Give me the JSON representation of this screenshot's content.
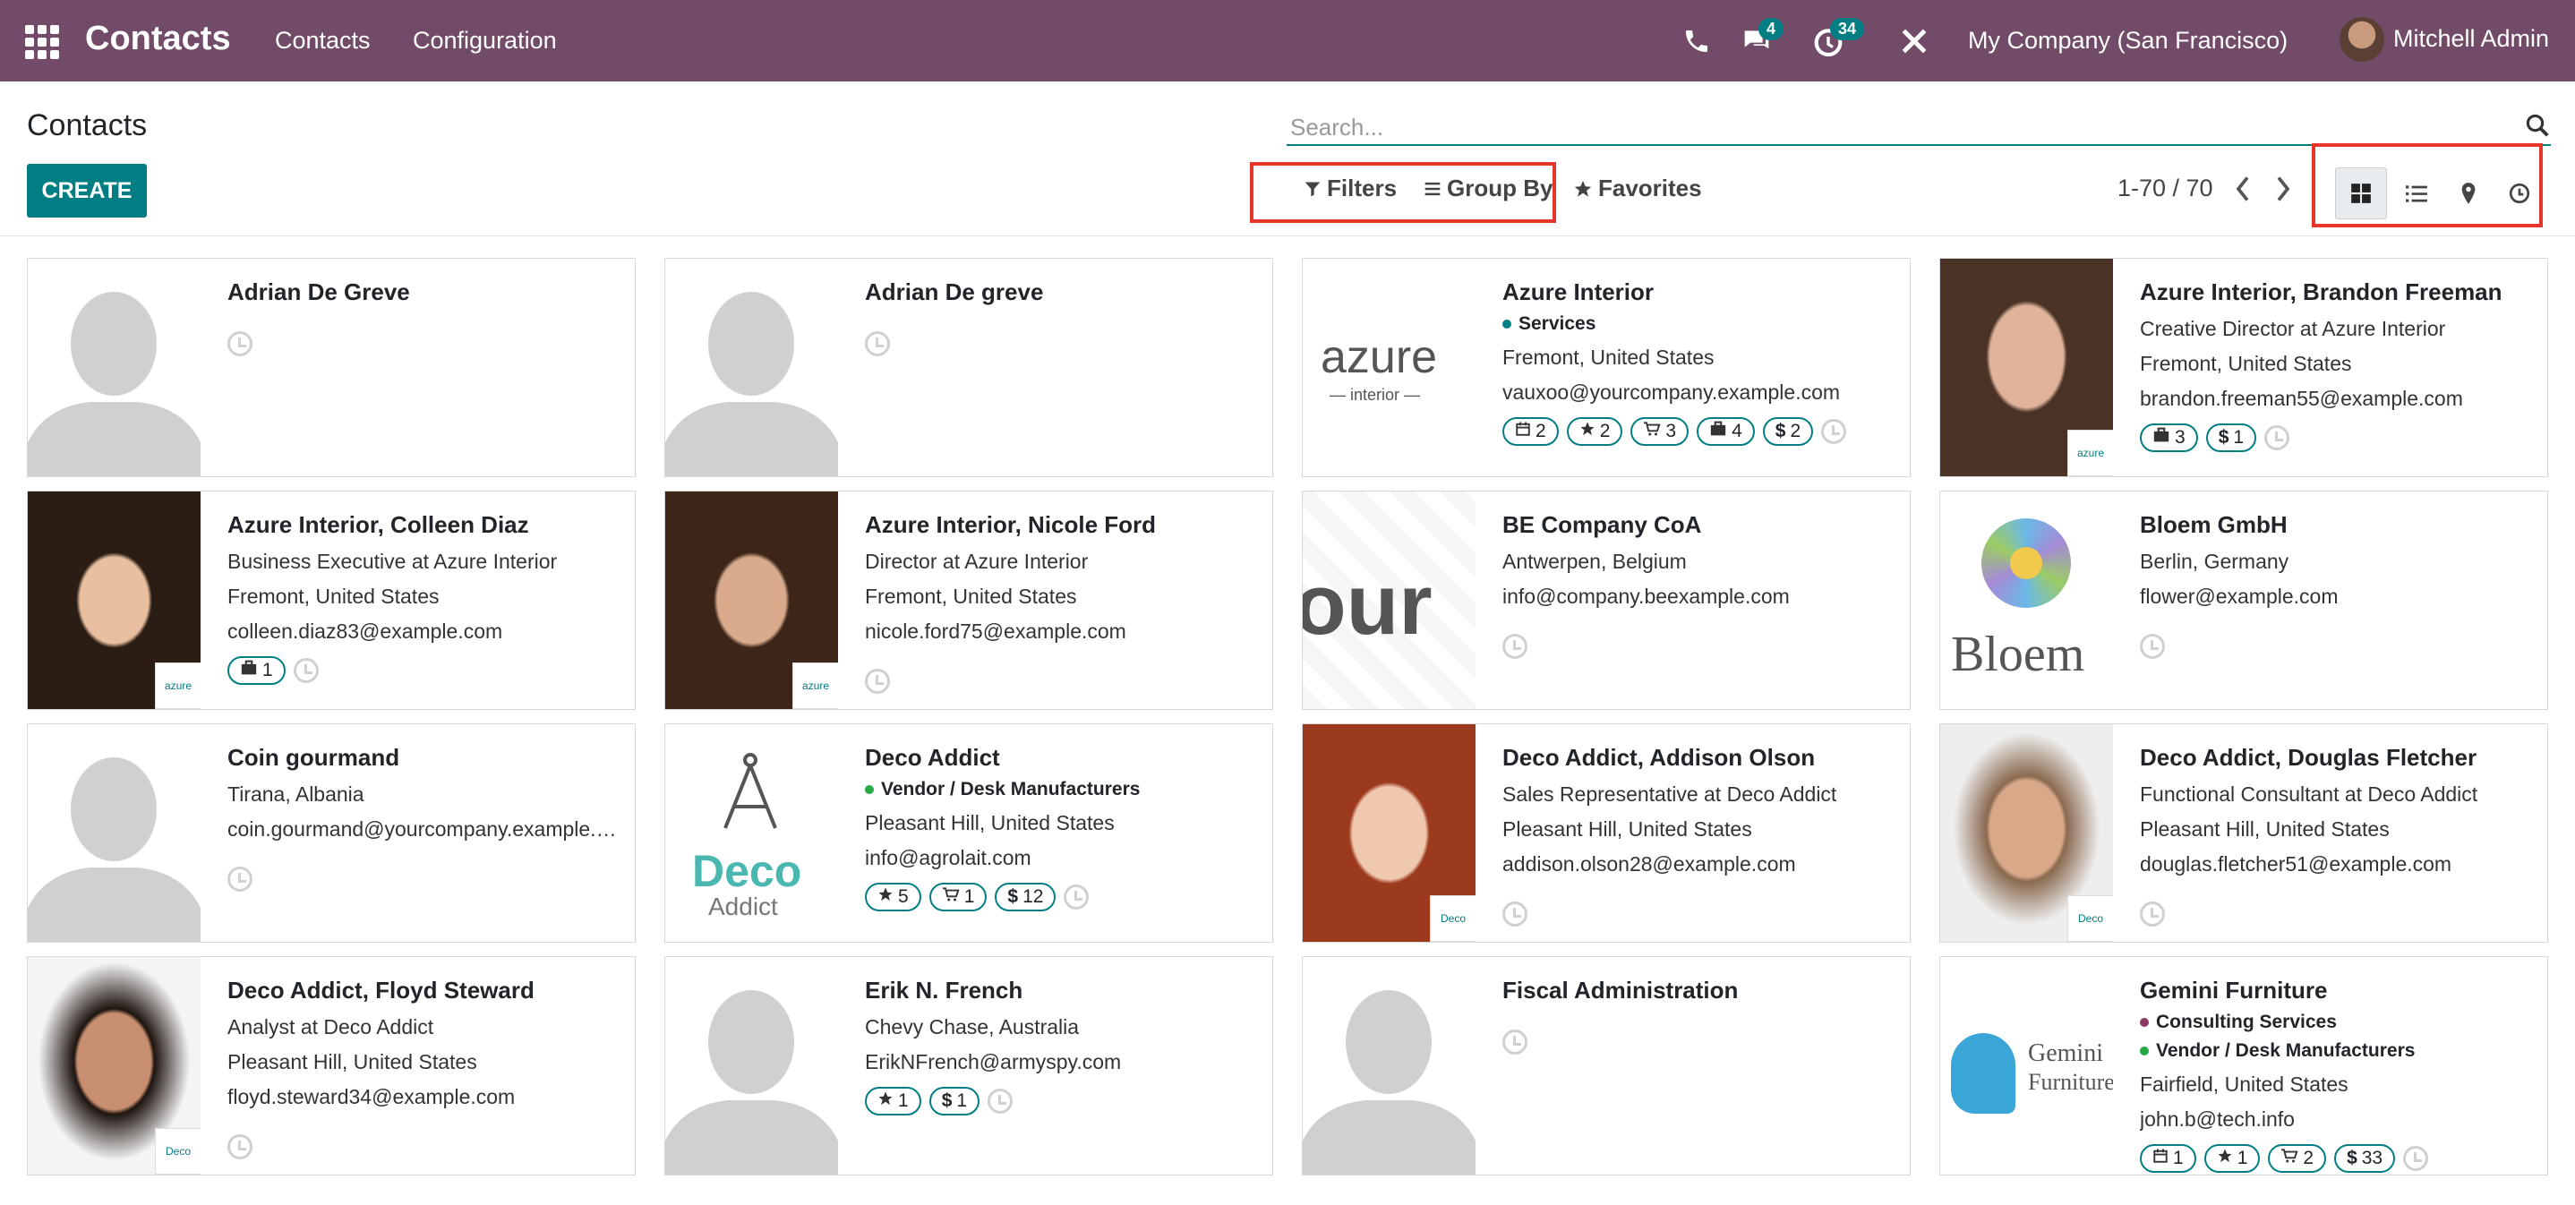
{
  "app": {
    "title": "Contacts",
    "menu": [
      "Contacts",
      "Configuration"
    ],
    "messages_badge": "4",
    "activity_badge": "34",
    "company": "My Company (San Francisco)",
    "user": "Mitchell Admin"
  },
  "controlpanel": {
    "breadcrumb": "Contacts",
    "create_label": "CREATE",
    "search_placeholder": "Search...",
    "filters_label": "Filters",
    "groupby_label": "Group By",
    "favorites_label": "Favorites",
    "pager": "1-70 / 70"
  },
  "colors": {
    "brand": "#714B67",
    "accent": "#017e84",
    "highlight": "#e53629"
  },
  "contacts": [
    {
      "name": "Adrian De Greve",
      "lines": [],
      "tags": [],
      "badges": [],
      "image": "placeholder"
    },
    {
      "name": "Adrian De greve",
      "lines": [],
      "tags": [],
      "badges": [],
      "image": "placeholder"
    },
    {
      "name": "Azure Interior",
      "tags": [
        {
          "label": "Services",
          "color": "#017e84"
        }
      ],
      "lines": [
        "Fremont, United States",
        "vauxoo@yourcompany.example.com"
      ],
      "badges": [
        {
          "icon": "calendar-icon",
          "count": "2"
        },
        {
          "icon": "star-icon",
          "count": "2"
        },
        {
          "icon": "cart-icon",
          "count": "3"
        },
        {
          "icon": "briefcase-icon",
          "count": "4"
        },
        {
          "icon": "dollar-icon",
          "count": "2"
        }
      ],
      "image": "azure-logo",
      "logo_text": "azure",
      "logo_sub": "interior"
    },
    {
      "name": "Azure Interior, Brandon Freeman",
      "lines": [
        "Creative Director at Azure Interior",
        "Fremont, United States",
        "brandon.freeman55@example.com"
      ],
      "tags": [],
      "badges": [
        {
          "icon": "briefcase-icon",
          "count": "3"
        },
        {
          "icon": "dollar-icon",
          "count": "1"
        }
      ],
      "image": "photo",
      "mini_logo": "azure"
    },
    {
      "name": "Azure Interior, Colleen Diaz",
      "lines": [
        "Business Executive at Azure Interior",
        "Fremont, United States",
        "colleen.diaz83@example.com"
      ],
      "tags": [],
      "badges": [
        {
          "icon": "briefcase-icon",
          "count": "1"
        }
      ],
      "image": "photo",
      "mini_logo": "azure"
    },
    {
      "name": "Azure Interior, Nicole Ford",
      "lines": [
        "Director at Azure Interior",
        "Fremont, United States",
        "nicole.ford75@example.com"
      ],
      "tags": [],
      "badges": [],
      "image": "photo",
      "mini_logo": "azure"
    },
    {
      "name": "BE Company CoA",
      "lines": [
        "Antwerpen, Belgium",
        "info@company.beexample.com"
      ],
      "tags": [],
      "badges": [],
      "image": "our-logo",
      "logo_text": "our"
    },
    {
      "name": "Bloem GmbH",
      "lines": [
        "Berlin, Germany",
        "flower@example.com"
      ],
      "tags": [],
      "badges": [],
      "image": "bloem-logo",
      "logo_text": "Bloem"
    },
    {
      "name": "Coin gourmand",
      "lines": [
        "Tirana, Albania",
        "coin.gourmand@yourcompany.example.com"
      ],
      "tags": [],
      "badges": [],
      "image": "placeholder"
    },
    {
      "name": "Deco Addict",
      "tags": [
        {
          "label": "Vendor / Desk Manufacturers",
          "color": "#28a745"
        }
      ],
      "lines": [
        "Pleasant Hill, United States",
        "info@agrolait.com"
      ],
      "badges": [
        {
          "icon": "star-icon",
          "count": "5"
        },
        {
          "icon": "cart-icon",
          "count": "1"
        },
        {
          "icon": "dollar-icon",
          "count": "12"
        }
      ],
      "image": "deco-logo",
      "logo_text": "Deco",
      "logo_sub": "Addict"
    },
    {
      "name": "Deco Addict, Addison Olson",
      "lines": [
        "Sales Representative at Deco Addict",
        "Pleasant Hill, United States",
        "addison.olson28@example.com"
      ],
      "tags": [],
      "badges": [],
      "image": "photo",
      "mini_logo": "Deco"
    },
    {
      "name": "Deco Addict, Douglas Fletcher",
      "lines": [
        "Functional Consultant at Deco Addict",
        "Pleasant Hill, United States",
        "douglas.fletcher51@example.com"
      ],
      "tags": [],
      "badges": [],
      "image": "photo",
      "mini_logo": "Deco"
    },
    {
      "name": "Deco Addict, Floyd Steward",
      "lines": [
        "Analyst at Deco Addict",
        "Pleasant Hill, United States",
        "floyd.steward34@example.com"
      ],
      "tags": [],
      "badges": [],
      "image": "photo",
      "mini_logo": "Deco"
    },
    {
      "name": "Erik N. French",
      "lines": [
        "Chevy Chase, Australia",
        "ErikNFrench@armyspy.com"
      ],
      "tags": [],
      "badges": [
        {
          "icon": "star-icon",
          "count": "1"
        },
        {
          "icon": "dollar-icon",
          "count": "1"
        }
      ],
      "image": "placeholder"
    },
    {
      "name": "Fiscal Administration",
      "lines": [],
      "tags": [],
      "badges": [],
      "image": "placeholder"
    },
    {
      "name": "Gemini Furniture",
      "tags": [
        {
          "label": "Consulting Services",
          "color": "#8b3a62"
        },
        {
          "label": "Vendor / Desk Manufacturers",
          "color": "#28a745"
        }
      ],
      "lines": [
        "Fairfield, United States",
        "john.b@tech.info"
      ],
      "badges": [
        {
          "icon": "calendar-icon",
          "count": "1"
        },
        {
          "icon": "star-icon",
          "count": "1"
        },
        {
          "icon": "cart-icon",
          "count": "2"
        },
        {
          "icon": "dollar-icon",
          "count": "33"
        }
      ],
      "image": "gemini-logo",
      "logo_text": "Gemini",
      "logo_sub": "Furniture"
    }
  ]
}
